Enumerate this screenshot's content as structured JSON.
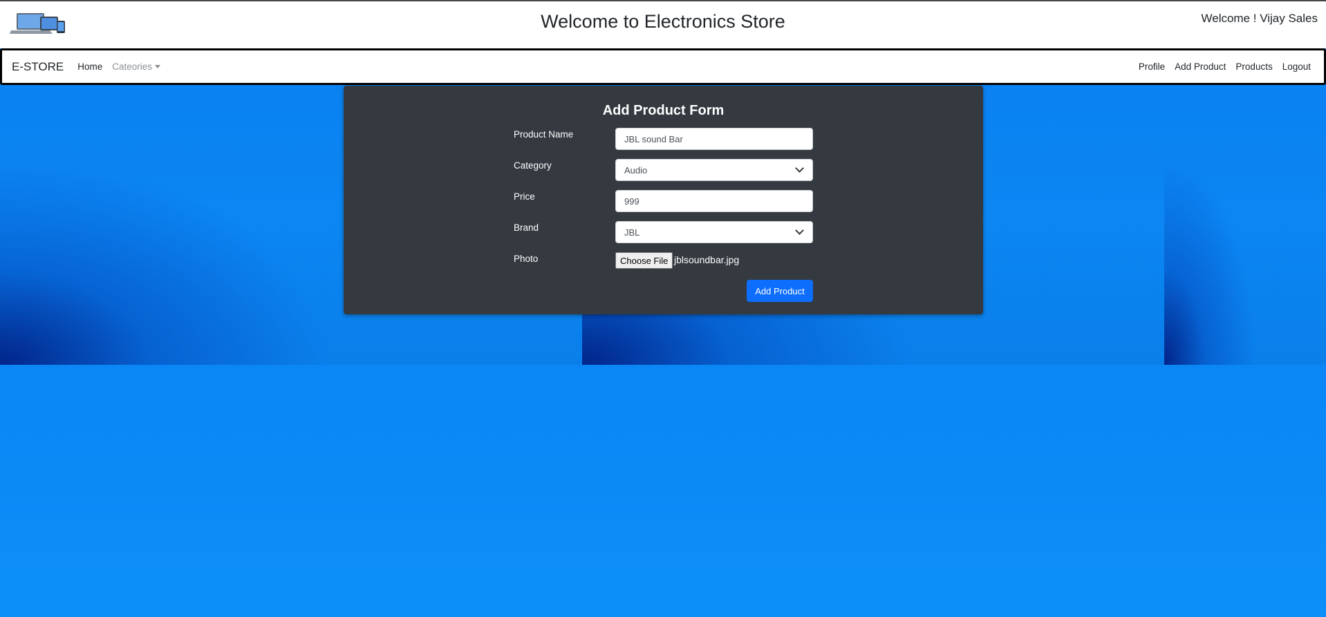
{
  "header": {
    "title": "Welcome to Electronics Store",
    "welcome_user": "Welcome ! Vijay Sales",
    "logo_icon": "devices-logo-icon"
  },
  "navbar": {
    "brand": "E-STORE",
    "left_links": [
      "Home",
      "Cateories"
    ],
    "right_links": [
      "Profile",
      "Add Product",
      "Products",
      "Logout"
    ]
  },
  "form": {
    "title": "Add Product Form",
    "product_name_label": "Product Name",
    "product_name_value": "JBL sound Bar",
    "category_label": "Category",
    "category_value": "Audio",
    "price_label": "Price",
    "price_value": "999",
    "brand_label": "Brand",
    "brand_value": "JBL",
    "photo_label": "Photo",
    "file_button_label": "Choose File",
    "file_name": "jblsoundbar.jpg",
    "submit_label": "Add Product"
  },
  "colors": {
    "card_bg": "#343a40",
    "primary_button": "#0d6efd",
    "background_blue": "#0a84ee"
  }
}
